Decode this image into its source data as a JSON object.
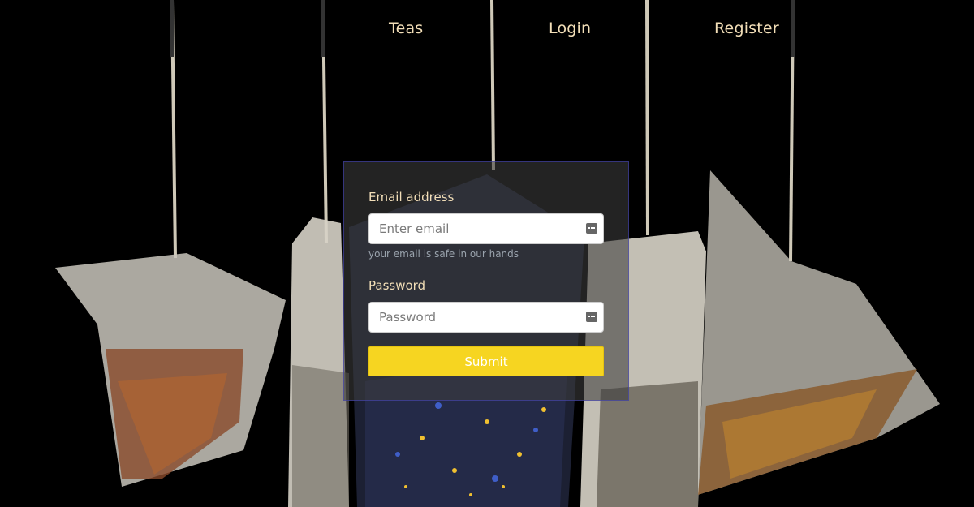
{
  "nav": {
    "teas": "Teas",
    "login": "Login",
    "register": "Register"
  },
  "form": {
    "email_label": "Email address",
    "email_placeholder": "Enter email",
    "email_value": "",
    "email_help": "your email is safe in our hands",
    "password_label": "Password",
    "password_placeholder": "Password",
    "password_value": "",
    "submit_label": "Submit"
  },
  "icons": {
    "field_autofill": "key-autofill-icon"
  },
  "colors": {
    "nav_text": "#f3dfb8",
    "label_text": "#f3dfb8",
    "help_text": "#9aa3ad",
    "submit_bg": "#f6d521",
    "card_bg": "rgba(60,60,60,0.58)",
    "card_border": "#4646c8"
  }
}
